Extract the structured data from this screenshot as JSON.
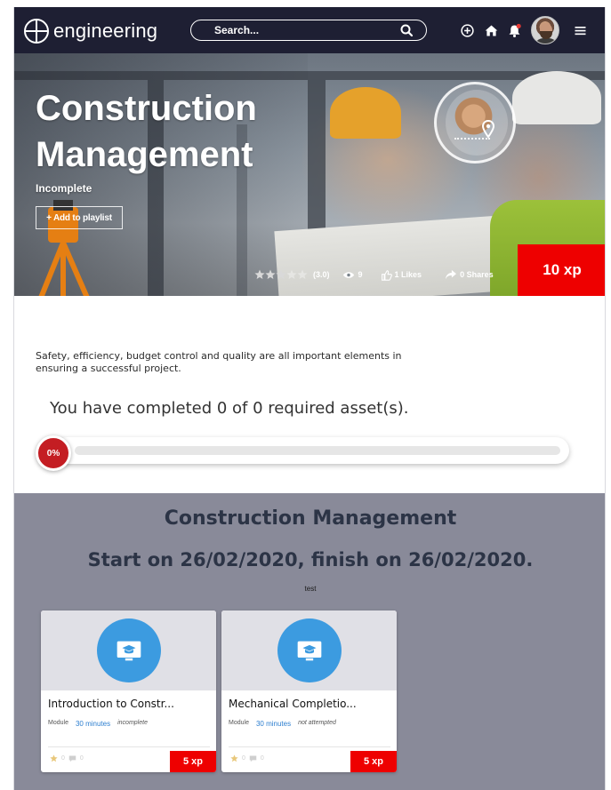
{
  "nav": {
    "logo_text": "engineering",
    "search_placeholder": "Search...",
    "icons": [
      "add-circle-icon",
      "home-icon",
      "bell-icon",
      "avatar",
      "menu-icon"
    ],
    "notification_color": "#e53935"
  },
  "hero": {
    "title": "Construction Management",
    "status": "Incomplete",
    "add_to_playlist": "+ Add to playlist",
    "rating": "(3.0)",
    "rating_value": 3,
    "rating_max": 5,
    "views": "9",
    "likes": "1 Likes",
    "shares": "0 Shares",
    "xp": "10 xp"
  },
  "description": "Safety, efficiency, budget control and quality are all important elements in ensuring a successful project.",
  "progress": {
    "text": "You have completed 0 of 0 required asset(s).",
    "percent_label": "0%",
    "percent_value": 0
  },
  "modules": {
    "title": "Construction Management",
    "dates": "Start on 26/02/2020, finish on 26/02/2020.",
    "note": "test",
    "cards": [
      {
        "name": "Introduction to Constr...",
        "type": "Module",
        "duration": "30 minutes",
        "status": "incomplete",
        "rating": "0",
        "comments": "0",
        "xp": "5 xp"
      },
      {
        "name": "Mechanical Completio...",
        "type": "Module",
        "duration": "30 minutes",
        "status": "not attempted",
        "rating": "0",
        "comments": "0",
        "xp": "5 xp"
      }
    ]
  },
  "colors": {
    "navbar": "#1e1f33",
    "accent_red": "#ee0000",
    "progress_bubble": "#c41d23",
    "modules_bg": "#898a99",
    "module_title": "#2c3446",
    "card_icon_bg": "#3c9be0",
    "duration_link": "#2d7fd0"
  }
}
